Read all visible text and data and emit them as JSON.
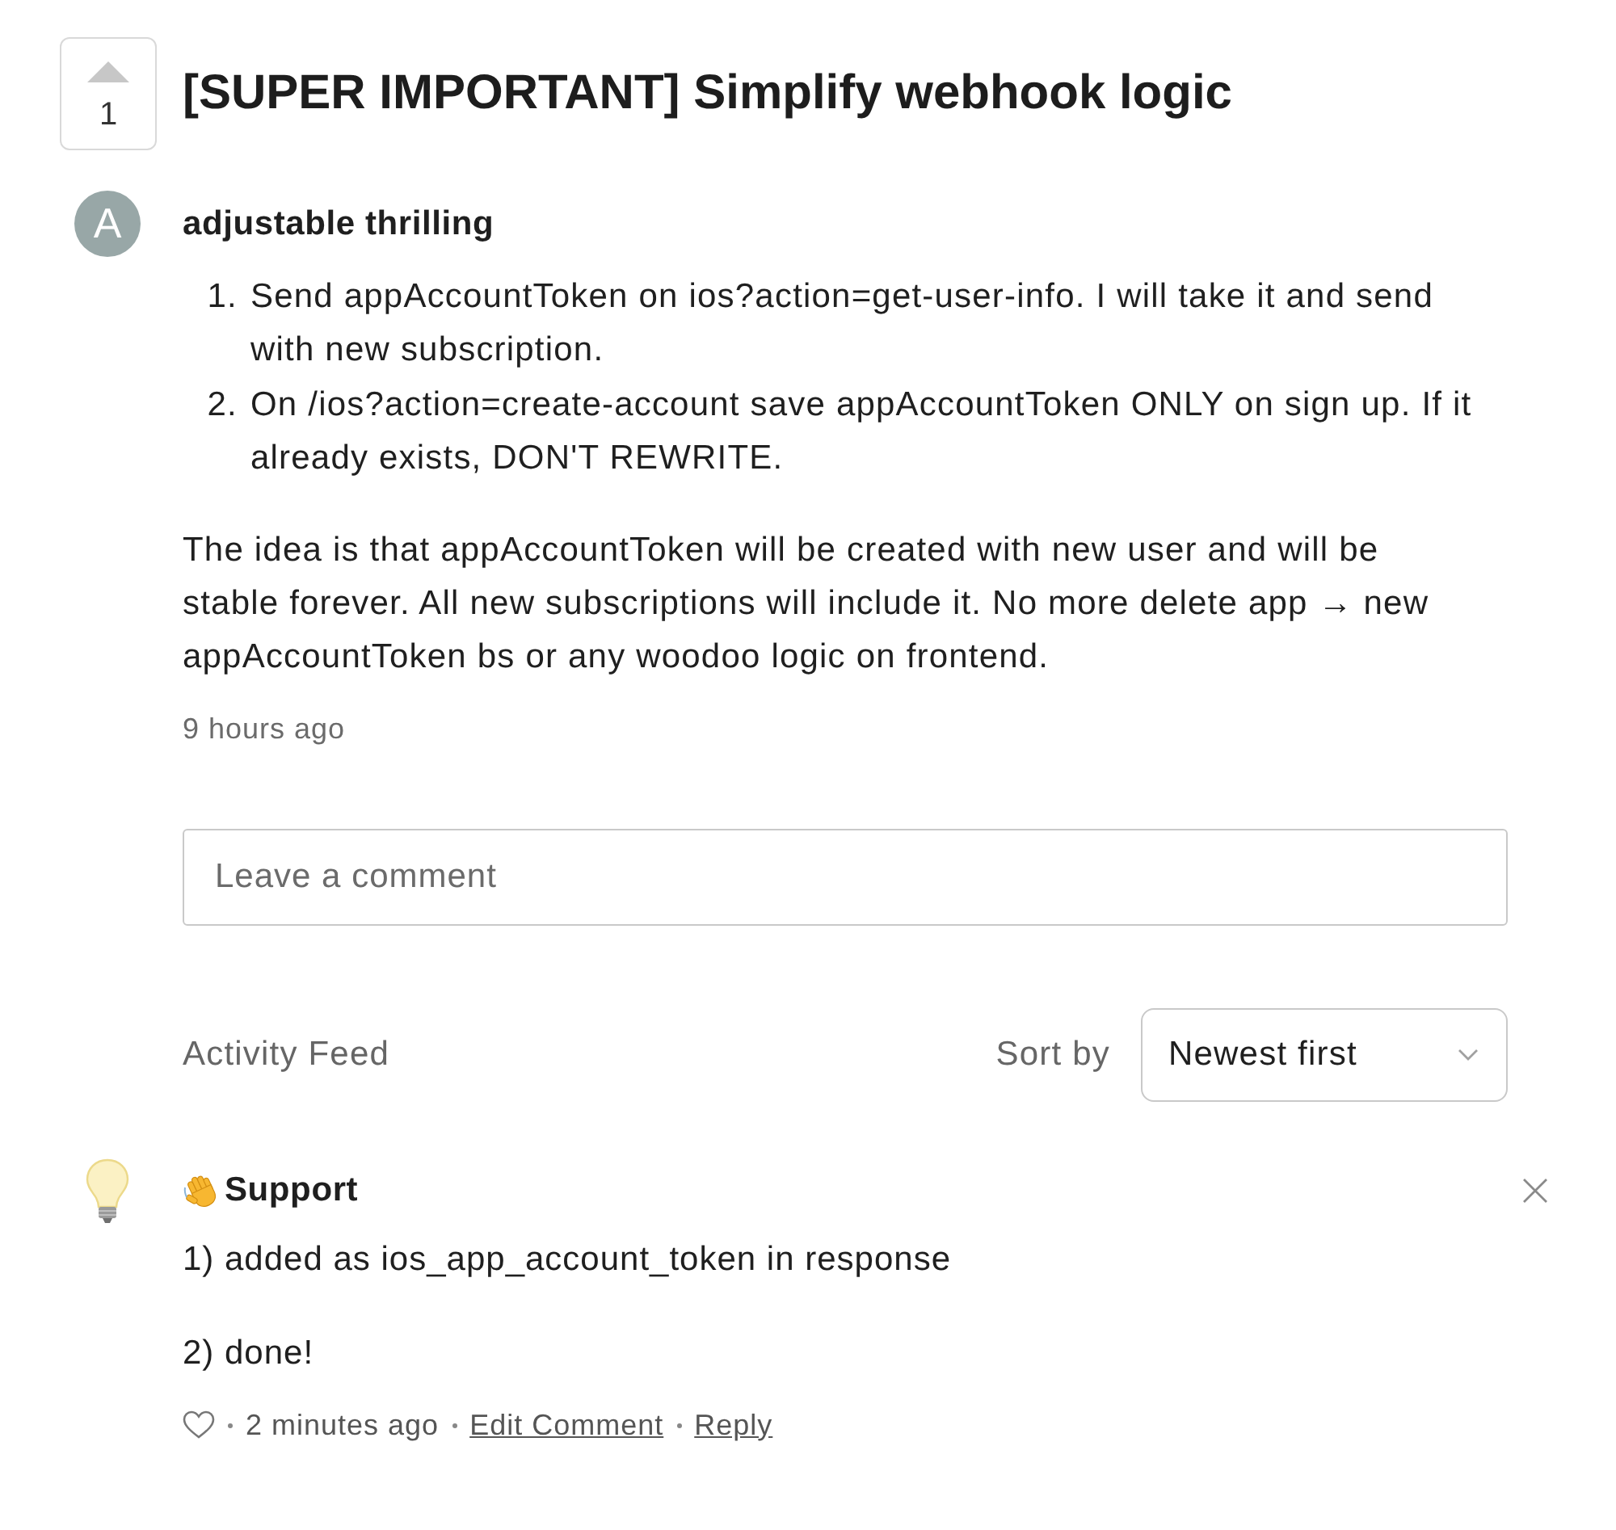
{
  "post": {
    "votes": "1",
    "title": "[SUPER IMPORTANT] Simplify webhook logic",
    "author": {
      "initial": "A",
      "name": "adjustable thrilling"
    },
    "steps": [
      {
        "number": "1.",
        "text": "Send appAccountToken on ios?action=get-user-info. I will take it and send with new subscription."
      },
      {
        "number": "2.",
        "text": "On /ios?action=create-account save appAccountToken ONLY on sign up. If it already exists, DON'T REWRITE."
      }
    ],
    "body": "The idea is that appAccountToken will be created with new user and will be stable forever. All new subscriptions will include it. No more delete app → new appAccountToken bs or any woodoo logic on frontend.",
    "time": "9 hours ago"
  },
  "comment_field": {
    "placeholder": "Leave a comment"
  },
  "activity_feed": {
    "heading": "Activity Feed",
    "sort_label": "Sort by",
    "sort_value": "Newest first"
  },
  "comments": [
    {
      "author": "Support",
      "paragraphs": [
        "1) added as ios_app_account_token in response",
        "2) done!"
      ],
      "time": "2 minutes ago",
      "actions": [
        "Edit Comment",
        "Reply"
      ]
    }
  ]
}
